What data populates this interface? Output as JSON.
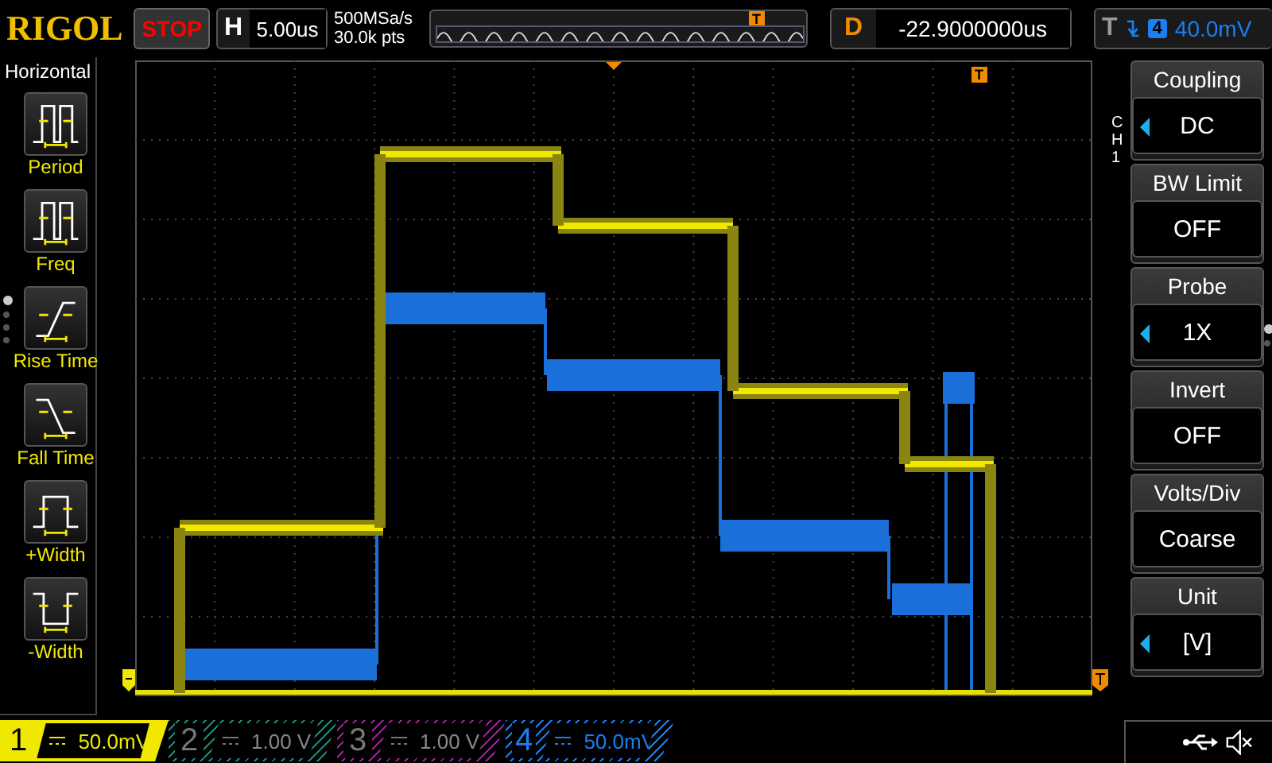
{
  "header": {
    "brand": "RIGOL",
    "run_state": "STOP",
    "timebase": {
      "label": "H",
      "value": "5.00us"
    },
    "sample_rate": "500MSa/s",
    "memory_depth": "30.0k pts",
    "minimap_marker": "T",
    "delay": {
      "label": "D",
      "value": "-22.9000000us"
    },
    "trigger": {
      "label": "T",
      "source": "4",
      "level": "40.0mV"
    }
  },
  "measure_menu": {
    "title": "Horizontal",
    "items": [
      {
        "kind": "period",
        "label": "Period"
      },
      {
        "kind": "freq",
        "label": "Freq"
      },
      {
        "kind": "rise",
        "label": "Rise Time"
      },
      {
        "kind": "fall",
        "label": "Fall Time"
      },
      {
        "kind": "pwidth",
        "label": "+Width"
      },
      {
        "kind": "nwidth",
        "label": "-Width"
      }
    ],
    "pages": [
      {
        "selected": true
      },
      {
        "selected": false
      },
      {
        "selected": false
      },
      {
        "selected": false
      }
    ]
  },
  "screen": {
    "trigger_marker": "T"
  },
  "channel_menu": {
    "channel": "CH1",
    "items": [
      {
        "title": "Coupling",
        "value": "DC",
        "adjustable": true
      },
      {
        "title": "BW Limit",
        "value": "OFF",
        "adjustable": false
      },
      {
        "title": "Probe",
        "value": "1X",
        "adjustable": true
      },
      {
        "title": "Invert",
        "value": "OFF",
        "adjustable": false
      },
      {
        "title": "Volts/Div",
        "value": "Coarse",
        "adjustable": false
      },
      {
        "title": "Unit",
        "value": "[V]",
        "adjustable": true
      }
    ],
    "pages": [
      {
        "selected": true
      },
      {
        "selected": false
      }
    ]
  },
  "channels": [
    {
      "number": "1",
      "scale": "50.0mV",
      "on": true,
      "selected": true,
      "color": "#f0e800"
    },
    {
      "number": "2",
      "scale": "1.00 V",
      "on": false,
      "selected": false,
      "color": "#1a8a7a"
    },
    {
      "number": "3",
      "scale": "1.00 V",
      "on": false,
      "selected": false,
      "color": "#a0209a"
    },
    {
      "number": "4",
      "scale": "50.0mV",
      "on": true,
      "selected": false,
      "color": "#1a7ff0"
    }
  ]
}
